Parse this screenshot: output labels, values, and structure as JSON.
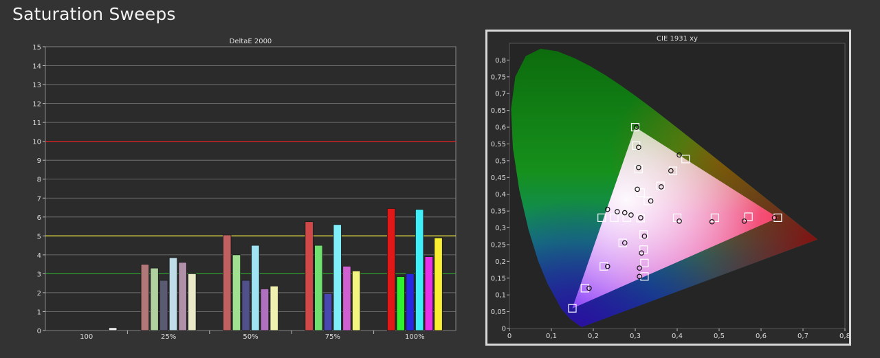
{
  "page": {
    "title": "Saturation Sweeps"
  },
  "colors": {
    "background": "#333333",
    "plot_bg": "#2b2b2b",
    "grid": "#7d7d7d",
    "red_ref": "#d02020",
    "yellow_ref": "#e6e040",
    "green_ref": "#2fa030"
  },
  "chart_data": [
    {
      "type": "bar",
      "title": "DeltaE 2000",
      "categories": [
        "100",
        "25%",
        "50%",
        "75%",
        "100%"
      ],
      "ylim": [
        0,
        15
      ],
      "yticks": [
        0,
        1,
        2,
        3,
        4,
        5,
        6,
        7,
        8,
        9,
        10,
        11,
        12,
        13,
        14,
        15
      ],
      "grid": true,
      "reference_lines": [
        {
          "y": 10,
          "color": "#d02020"
        },
        {
          "y": 5,
          "color": "#e6e040"
        },
        {
          "y": 3,
          "color": "#2fa030"
        }
      ],
      "groups": [
        {
          "category": "100",
          "bars": [
            {
              "value": 0.15,
              "color": "#f0f0f0"
            }
          ]
        },
        {
          "category": "25%",
          "bars": [
            {
              "value": 3.5,
              "color": "#b07878"
            },
            {
              "value": 3.3,
              "color": "#b0d0a0"
            },
            {
              "value": 2.65,
              "color": "#5a5a72"
            },
            {
              "value": 3.85,
              "color": "#c0dce8"
            },
            {
              "value": 3.6,
              "color": "#b090a8"
            },
            {
              "value": 3.0,
              "color": "#eaeac8"
            }
          ]
        },
        {
          "category": "50%",
          "bars": [
            {
              "value": 5.05,
              "color": "#c06060"
            },
            {
              "value": 4.0,
              "color": "#a0e090"
            },
            {
              "value": 2.65,
              "color": "#50508a"
            },
            {
              "value": 4.5,
              "color": "#a0e4f4"
            },
            {
              "value": 2.2,
              "color": "#b070c0"
            },
            {
              "value": 2.35,
              "color": "#f0f0b0"
            }
          ]
        },
        {
          "category": "75%",
          "bars": [
            {
              "value": 5.75,
              "color": "#d04848"
            },
            {
              "value": 4.5,
              "color": "#70e070"
            },
            {
              "value": 1.95,
              "color": "#4848b0"
            },
            {
              "value": 5.6,
              "color": "#80eef8"
            },
            {
              "value": 3.4,
              "color": "#d060d0"
            },
            {
              "value": 3.15,
              "color": "#f4f480"
            }
          ]
        },
        {
          "category": "100%",
          "bars": [
            {
              "value": 6.45,
              "color": "#e01818"
            },
            {
              "value": 2.85,
              "color": "#30f030"
            },
            {
              "value": 3.0,
              "color": "#2828e0"
            },
            {
              "value": 6.4,
              "color": "#40f0f8"
            },
            {
              "value": 3.9,
              "color": "#e830e8"
            },
            {
              "value": 4.9,
              "color": "#f8f030"
            }
          ]
        }
      ]
    },
    {
      "type": "scatter",
      "title": "CIE 1931 xy",
      "xlim": [
        0,
        0.8
      ],
      "ylim": [
        0,
        0.85
      ],
      "xticks": [
        0,
        0.1,
        0.2,
        0.3,
        0.4,
        0.5,
        0.6,
        0.7,
        0.8
      ],
      "xtick_labels": [
        "0",
        "0,1",
        "0,2",
        "0,3",
        "0,4",
        "0,5",
        "0,6",
        "0,7",
        "0,8"
      ],
      "yticks": [
        0,
        0.05,
        0.1,
        0.15,
        0.2,
        0.25,
        0.3,
        0.35,
        0.4,
        0.45,
        0.5,
        0.55,
        0.6,
        0.65,
        0.7,
        0.75,
        0.8
      ],
      "ytick_labels": [
        "0",
        "0,05",
        "0,1",
        "0,15",
        "0,2",
        "0,25",
        "0,3",
        "0,35",
        "0,4",
        "0,45",
        "0,5",
        "0,55",
        "0,6",
        "0,65",
        "0,7",
        "0,75",
        "0,8"
      ],
      "gamut": [
        [
          0.64,
          0.33
        ],
        [
          0.3,
          0.6
        ],
        [
          0.15,
          0.06
        ]
      ],
      "targets": [
        [
          0.3127,
          0.329
        ],
        [
          0.4,
          0.33
        ],
        [
          0.49,
          0.33
        ],
        [
          0.57,
          0.333
        ],
        [
          0.64,
          0.33
        ],
        [
          0.3,
          0.6
        ],
        [
          0.302,
          0.545
        ],
        [
          0.308,
          0.475
        ],
        [
          0.313,
          0.405
        ],
        [
          0.33,
          0.38
        ],
        [
          0.15,
          0.06
        ],
        [
          0.18,
          0.12
        ],
        [
          0.225,
          0.185
        ],
        [
          0.27,
          0.255
        ],
        [
          0.22,
          0.33
        ],
        [
          0.25,
          0.33
        ],
        [
          0.28,
          0.33
        ],
        [
          0.32,
          0.28
        ],
        [
          0.32,
          0.235
        ],
        [
          0.322,
          0.195
        ],
        [
          0.322,
          0.155
        ],
        [
          0.42,
          0.505
        ],
        [
          0.39,
          0.47
        ],
        [
          0.36,
          0.425
        ]
      ],
      "measured": [
        [
          0.313,
          0.33
        ],
        [
          0.405,
          0.32
        ],
        [
          0.483,
          0.318
        ],
        [
          0.56,
          0.32
        ],
        [
          0.632,
          0.33
        ],
        [
          0.303,
          0.6
        ],
        [
          0.308,
          0.54
        ],
        [
          0.308,
          0.48
        ],
        [
          0.305,
          0.415
        ],
        [
          0.337,
          0.38
        ],
        [
          0.19,
          0.12
        ],
        [
          0.234,
          0.185
        ],
        [
          0.275,
          0.255
        ],
        [
          0.234,
          0.355
        ],
        [
          0.257,
          0.348
        ],
        [
          0.275,
          0.345
        ],
        [
          0.29,
          0.338
        ],
        [
          0.322,
          0.275
        ],
        [
          0.315,
          0.225
        ],
        [
          0.31,
          0.18
        ],
        [
          0.31,
          0.155
        ],
        [
          0.405,
          0.517
        ],
        [
          0.385,
          0.47
        ],
        [
          0.362,
          0.422
        ]
      ]
    }
  ]
}
